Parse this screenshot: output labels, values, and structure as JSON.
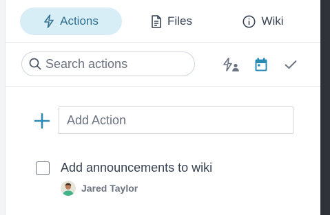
{
  "tabs": [
    {
      "label": "Actions",
      "icon": "lightning-icon",
      "active": true
    },
    {
      "label": "Files",
      "icon": "document-icon",
      "active": false
    },
    {
      "label": "Wiki",
      "icon": "info-icon",
      "active": false
    }
  ],
  "toolbar": {
    "search_placeholder": "Search actions",
    "filters": [
      {
        "icon": "assigned-to-me-icon"
      },
      {
        "icon": "calendar-icon",
        "color": "#2a8ab5"
      },
      {
        "icon": "checkmark-icon"
      }
    ]
  },
  "add_action": {
    "placeholder": "Add Action"
  },
  "actions": [
    {
      "title": "Add announcements to wiki",
      "checked": false,
      "assignee": "Jared Taylor"
    }
  ],
  "colors": {
    "accent": "#2a8ab5",
    "active_tab_bg": "#d7eef7",
    "text": "#374151",
    "muted": "#6b7280"
  }
}
